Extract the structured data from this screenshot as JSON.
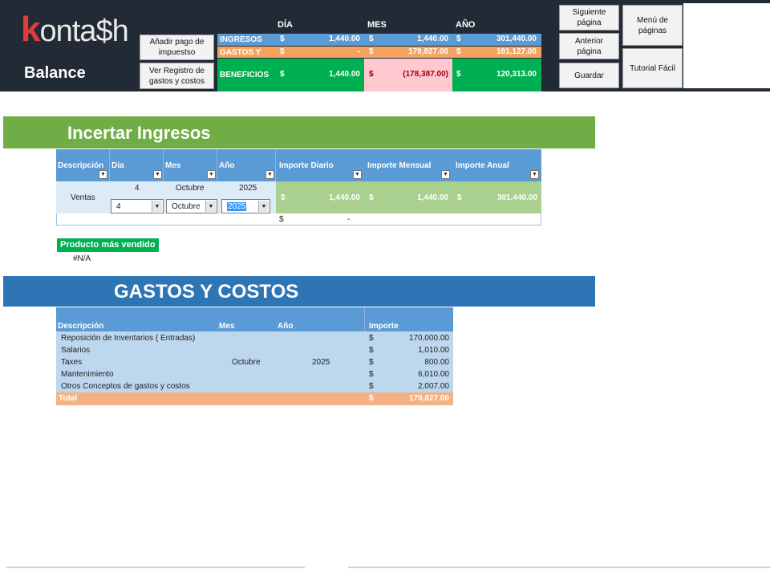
{
  "header": {
    "logo_text": "kontash",
    "logo_k": "k",
    "logo_rest": "onta$h",
    "page_title": "Balance",
    "buttons": {
      "add_tax": "Añadir pago de impuestso",
      "view_register": "Ver Registro de gastos y costos",
      "next_page": "Siguiente página",
      "prev_page": "Anterior página",
      "save": "Guardar",
      "menu": "Menú de páginas",
      "tutorial": "Tutorial Fácil"
    },
    "columns": {
      "dia": "DÍA",
      "mes": "MES",
      "ano": "AÑO"
    },
    "summary": {
      "ingresos": {
        "label": "INGRESOS",
        "dia": "1,440.00",
        "mes": "1,440.00",
        "ano": "301,440.00"
      },
      "gastos": {
        "label": "GASTOS Y",
        "dia": "-",
        "mes": "179,827.00",
        "ano": "181,127.00"
      },
      "beneficios": {
        "label": "BENEFICIOS",
        "dia": "1,440.00",
        "mes": "(178,387.00)",
        "ano": "120,313.00"
      },
      "currency": "$"
    }
  },
  "ingresos_section": {
    "title": "Incertar Ingresos",
    "headers": [
      "Descripción",
      "Día",
      "Mes",
      "Año",
      "Importe Diario",
      "Importe Mensual",
      "Importe Anual"
    ],
    "row": {
      "descripcion": "Ventas",
      "dia": "4",
      "mes": "Octubre",
      "ano": "2025",
      "importe_diario": "1,440.00",
      "importe_mensual": "1,440.00",
      "importe_anual": "301,440.00"
    },
    "selects": {
      "dia": "4",
      "mes": "Octubre",
      "ano": "2025"
    },
    "total_row": {
      "currency": "$",
      "value": "-"
    },
    "currency": "$"
  },
  "best_seller": {
    "label": "Producto más vendido",
    "value": "#N/A"
  },
  "gastos_section": {
    "title": "GASTOS Y COSTOS",
    "headers": {
      "descripcion": "Descripción",
      "mes": "Mes",
      "ano": "Año",
      "importe": "Importe"
    },
    "mes": "Octubre",
    "ano": "2025",
    "rows": [
      {
        "descripcion": "Reposición de Inventarios ( Entradas)",
        "importe": "170,000.00"
      },
      {
        "descripcion": "Salarios",
        "importe": "1,010.00"
      },
      {
        "descripcion": "Taxes",
        "importe": "800.00"
      },
      {
        "descripcion": "Mantenimiento",
        "importe": "6,010.00"
      },
      {
        "descripcion": "Otros Conceptos de gastos y costos",
        "importe": "2,007.00"
      }
    ],
    "total_label": "Total",
    "total": "179,827.00",
    "currency": "$"
  },
  "colors": {
    "header_bg": "#222a36",
    "ingresos_blue": "#5b9bd5",
    "gastos_orange": "#f4a460",
    "beneficios_green": "#00b050",
    "negative_pink": "#ffc7ce",
    "section_green": "#70ad47",
    "section_blue": "#2e75b6",
    "table_light_blue": "#bdd7ee",
    "table_green": "#a9d08e",
    "total_orange": "#f4b183"
  }
}
